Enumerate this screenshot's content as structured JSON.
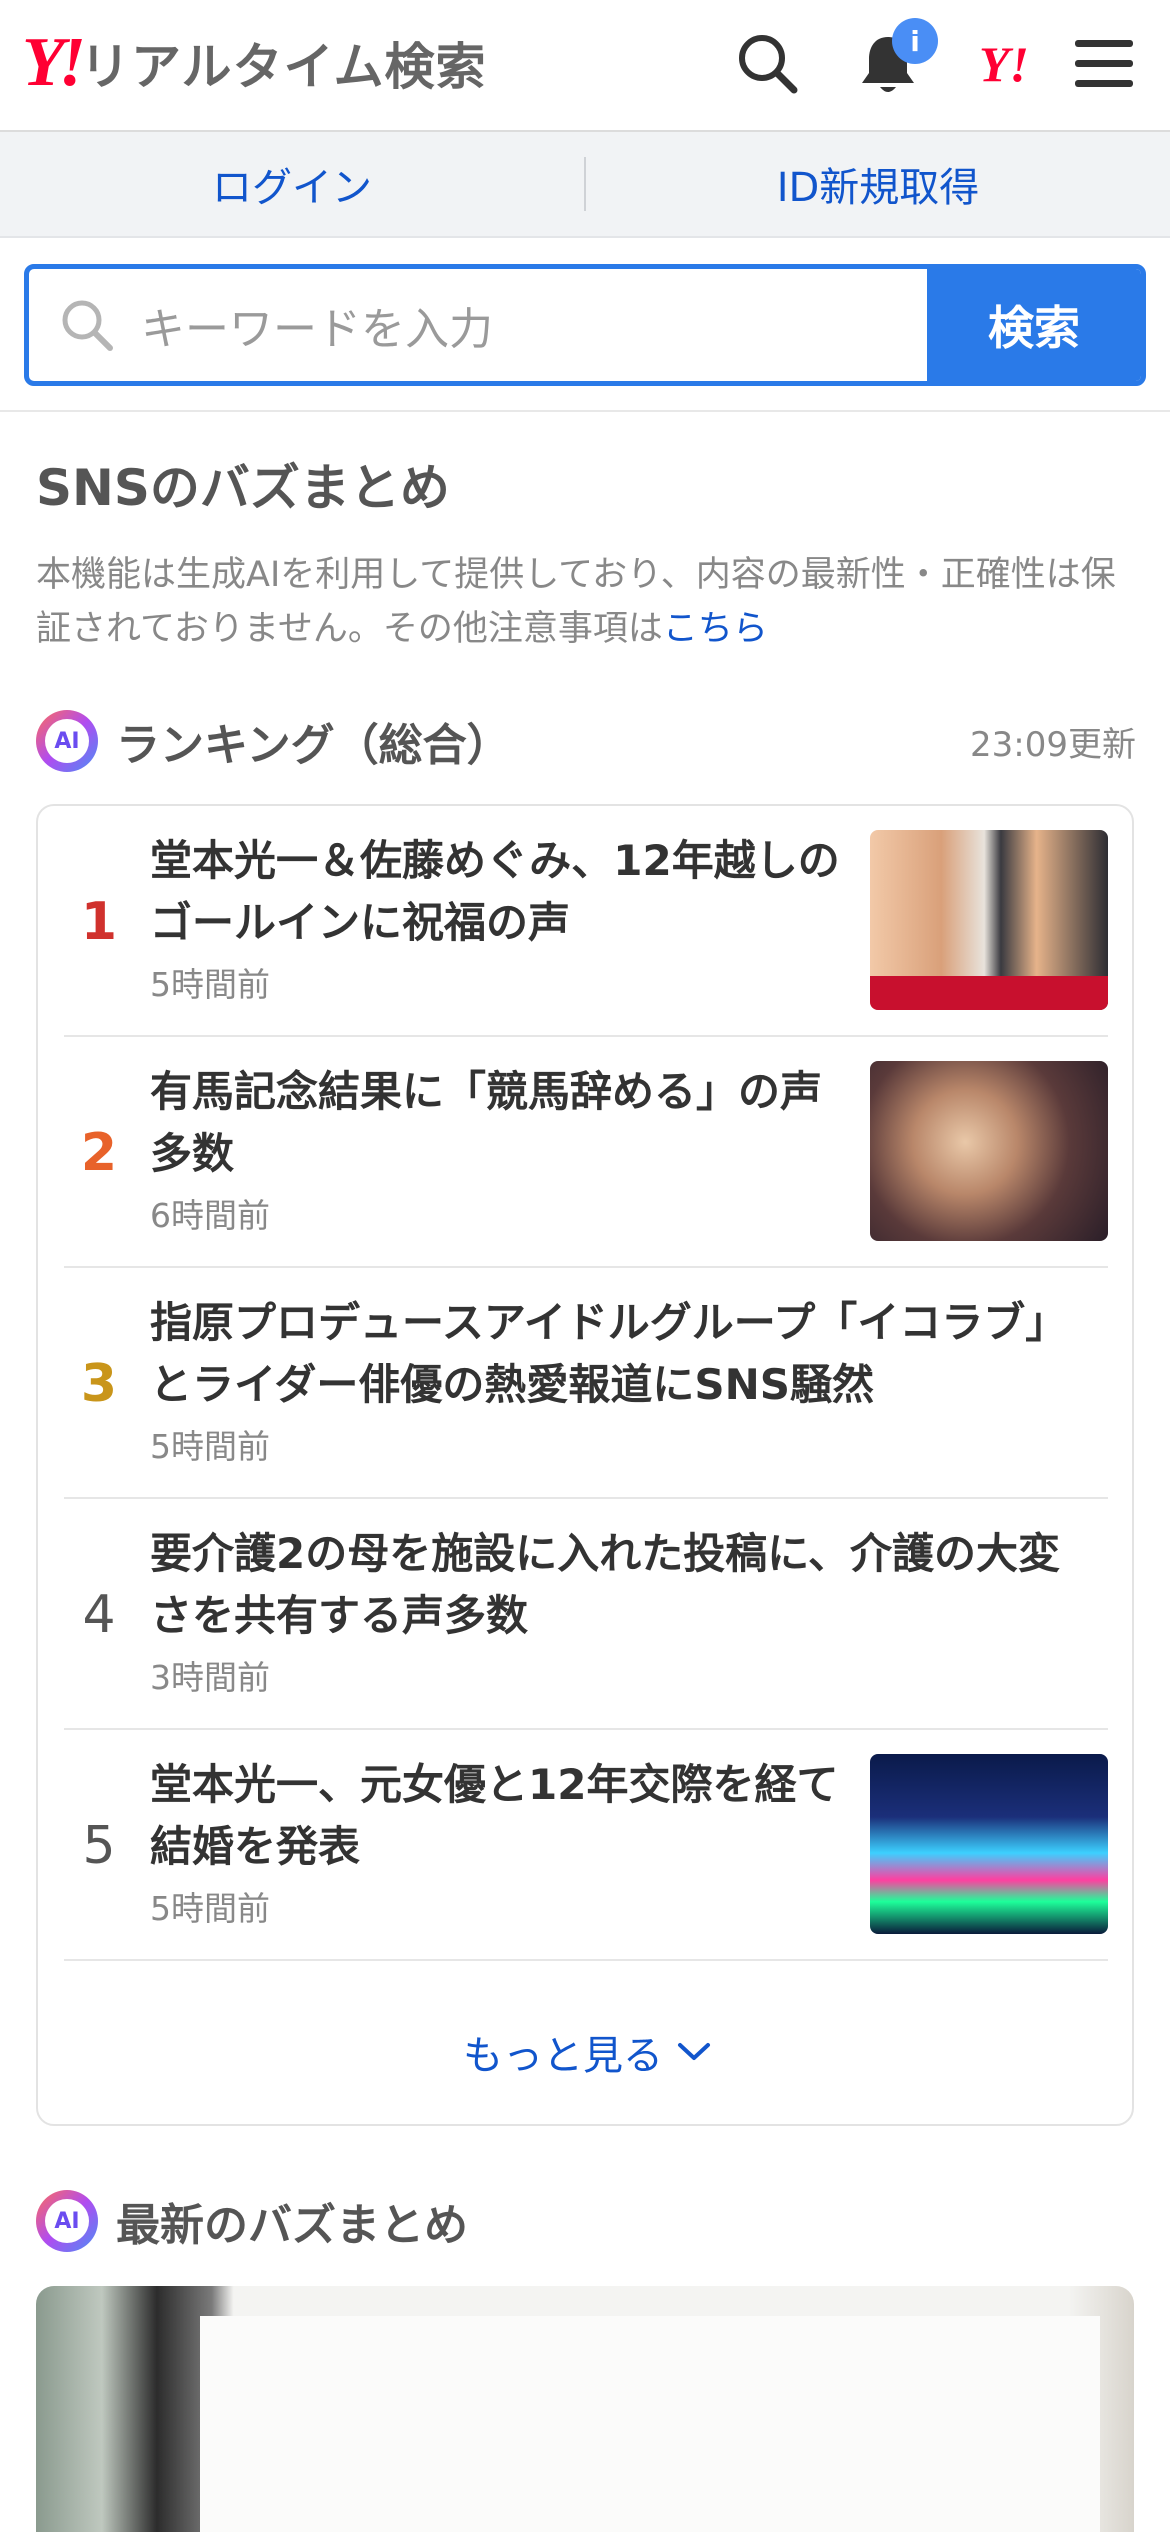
{
  "header": {
    "logo_mark": "Y!",
    "logo_text": "リアルタイム検索",
    "notification_badge": "i",
    "yahoo_mark": "Y!"
  },
  "login_bar": {
    "login_label": "ログイン",
    "register_label": "ID新規取得"
  },
  "search": {
    "placeholder": "キーワードを入力",
    "button_label": "検索"
  },
  "sns_section": {
    "title": "SNSのバズまとめ",
    "disclaimer": "本機能は生成AIを利用して提供しており、内容の最新性・正確性は保証されておりません。その他注意事項は",
    "disclaimer_link": "こちら"
  },
  "ranking": {
    "ai_badge": "AI",
    "title": "ランキング（総合）",
    "updated": "23:09更新",
    "items": [
      {
        "rank": "1",
        "headline": "堂本光一＆佐藤めぐみ、12年越しのゴールインに祝福の声",
        "time": "5時間前",
        "rank_color": "#d0312d",
        "has_thumb": true
      },
      {
        "rank": "2",
        "headline": "有馬記念結果に「競馬辞める」の声多数",
        "time": "6時間前",
        "rank_color": "#e8622a",
        "has_thumb": true
      },
      {
        "rank": "3",
        "headline": "指原プロデュースアイドルグループ「イコラブ」とライダー俳優の熱愛報道にSNS騒然",
        "time": "5時間前",
        "rank_color": "#c9951a",
        "has_thumb": false
      },
      {
        "rank": "4",
        "headline": "要介護2の母を施設に入れた投稿に、介護の大変さを共有する声多数",
        "time": "3時間前",
        "rank_color": "#555555",
        "has_thumb": false
      },
      {
        "rank": "5",
        "headline": "堂本光一、元女優と12年交際を経て結婚を発表",
        "time": "5時間前",
        "rank_color": "#555555",
        "has_thumb": true
      }
    ],
    "more_label": "もっと見る"
  },
  "latest": {
    "ai_badge": "AI",
    "title": "最新のバズまとめ"
  }
}
